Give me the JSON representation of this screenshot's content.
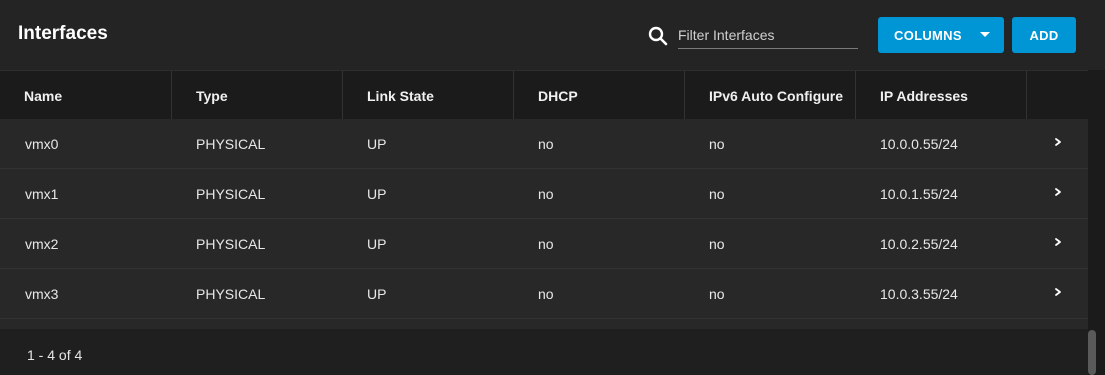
{
  "header": {
    "title": "Interfaces",
    "filter_placeholder": "Filter Interfaces",
    "columns_label": "COLUMNS",
    "add_label": "ADD"
  },
  "table": {
    "columns": [
      "Name",
      "Type",
      "Link State",
      "DHCP",
      "IPv6 Auto Configure",
      "IP Addresses"
    ],
    "rows": [
      [
        "vmx0",
        "PHYSICAL",
        "UP",
        "no",
        "no",
        "10.0.0.55/24"
      ],
      [
        "vmx1",
        "PHYSICAL",
        "UP",
        "no",
        "no",
        "10.0.1.55/24"
      ],
      [
        "vmx2",
        "PHYSICAL",
        "UP",
        "no",
        "no",
        "10.0.2.55/24"
      ],
      [
        "vmx3",
        "PHYSICAL",
        "UP",
        "no",
        "no",
        "10.0.3.55/24"
      ]
    ]
  },
  "footer": {
    "pager_text": "1 - 4 of 4"
  },
  "icons": {
    "search": "search-icon",
    "columns_caret": "chevron-down-icon",
    "row_expand": "chevron-right-icon"
  },
  "colors": {
    "accent": "#0095d5",
    "background": "#242424"
  }
}
